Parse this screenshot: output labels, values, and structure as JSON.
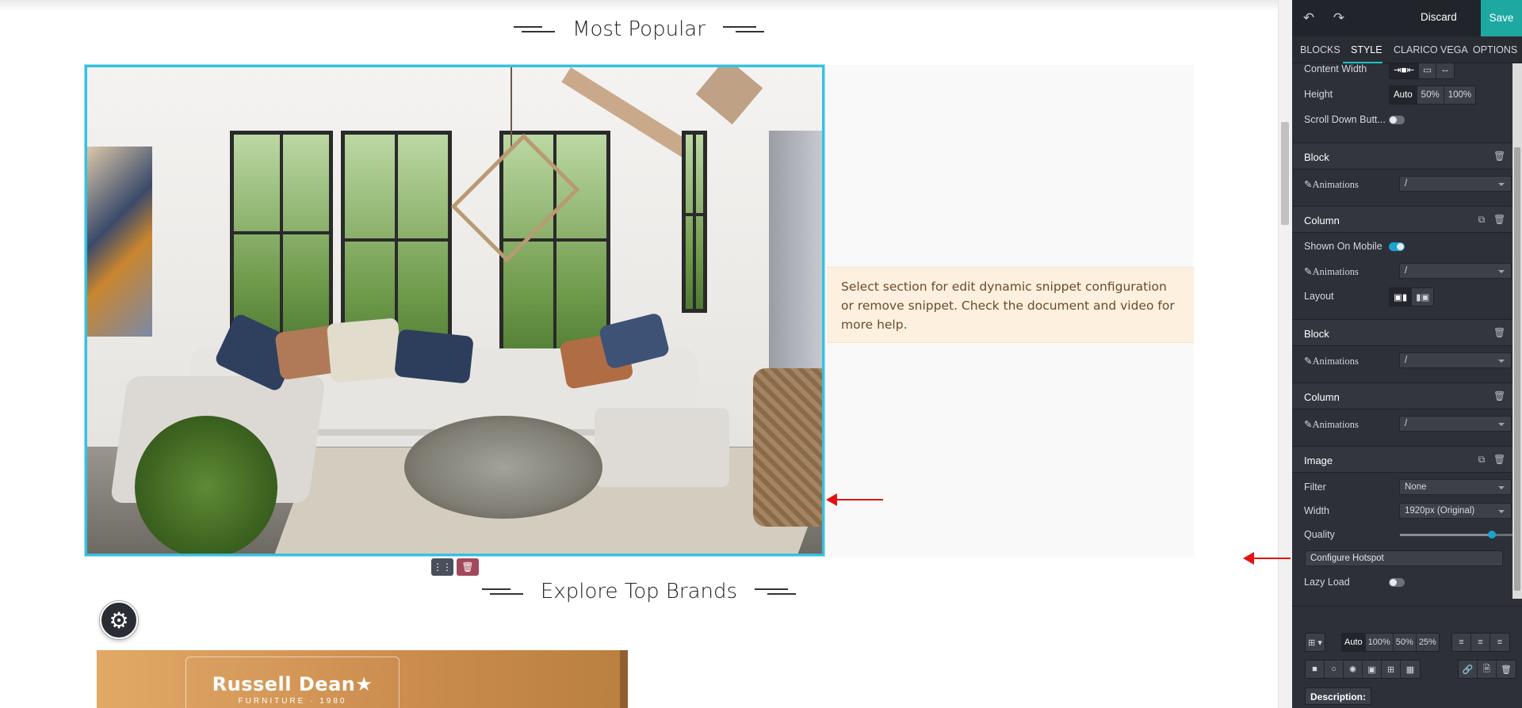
{
  "canvas": {
    "popular_title": "Most Popular",
    "brands_title": "Explore Top Brands",
    "snippet_note": "Select section for edit dynamic snippet configuration or remove snippet. Check the document and video for more help.",
    "brand_name": "Russell Dean★",
    "brand_sub": "FURNITURE · 1980",
    "move_icon": "move-handle-icon",
    "delete_icon": "trash-icon",
    "settings_icon": "gear-icon"
  },
  "editor": {
    "undo_icon": "undo-icon",
    "redo_icon": "redo-icon",
    "discard": "Discard",
    "save": "Save",
    "tabs": [
      "BLOCKS",
      "STYLE",
      "CLARICO VEGA",
      "OPTIONS"
    ],
    "active_tab": "STYLE",
    "accent": "#1ea8a2",
    "section": {
      "content_width_label": "Content Width",
      "height_label": "Height",
      "height_options": [
        "Auto",
        "50%",
        "100%"
      ],
      "height_selected": "Auto",
      "scroll_down_label": "Scroll Down Butt...",
      "scroll_down_on": false
    },
    "block1": {
      "title": "Block",
      "animations_label": "Animations",
      "animations_value": "/"
    },
    "column1": {
      "title": "Column",
      "shown_on_mobile_label": "Shown On Mobile",
      "shown_on_mobile_on": true,
      "animations_label": "Animations",
      "animations_value": "/",
      "layout_label": "Layout"
    },
    "block2": {
      "title": "Block",
      "animations_label": "Animations",
      "animations_value": "/"
    },
    "column2": {
      "title": "Column",
      "animations_label": "Animations",
      "animations_value": "/"
    },
    "image": {
      "title": "Image",
      "filter_label": "Filter",
      "filter_value": "None",
      "width_label": "Width",
      "width_value": "1920px (Original)",
      "quality_label": "Quality",
      "quality_fraction": 0.82,
      "hotspot_button": "Configure Hotspot",
      "lazy_load_label": "Lazy Load",
      "lazy_load_on": false
    },
    "bottom": {
      "size_options": [
        "Auto",
        "100%",
        "50%",
        "25%"
      ],
      "size_selected": "Auto",
      "description_button": "Description:"
    }
  }
}
